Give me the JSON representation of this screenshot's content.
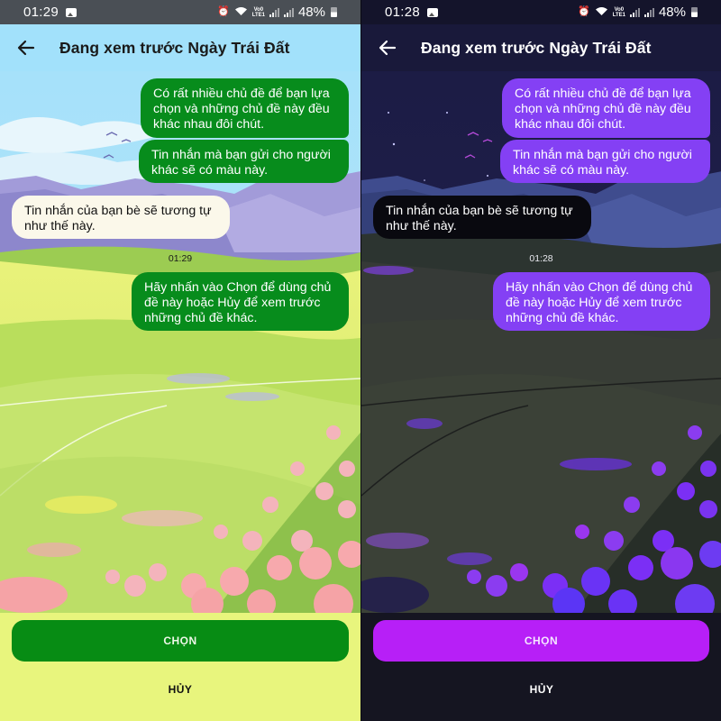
{
  "screens": [
    {
      "theme": "light",
      "status_bar": {
        "time": "01:29",
        "battery": "48%",
        "icons": [
          "gallery-icon",
          "alarm-icon",
          "wifi-icon",
          "volte-lte-icon",
          "signal-icon",
          "signal-icon",
          "battery-icon"
        ]
      },
      "app_bar": {
        "back_icon": "arrow-left-icon",
        "title": "Đang xem trước Ngày Trái Đất"
      },
      "messages": [
        {
          "direction": "outgoing",
          "text": "Có rất nhiều chủ đề để bạn lựa chọn và những chủ đề này đều khác nhau đôi chút."
        },
        {
          "direction": "outgoing",
          "text": "Tin nhắn mà bạn gửi cho người khác sẽ có màu này."
        },
        {
          "direction": "incoming",
          "text": "Tin nhắn của bạn bè sẽ tương tự như thế này."
        },
        {
          "direction": "outgoing",
          "text": "Hãy nhấn vào Chọn để dùng chủ đề này hoặc Hủy để xem trước những chủ đề khác."
        }
      ],
      "timestamp": "01:29",
      "choose_button": "CHỌN",
      "cancel_button": "HỦY",
      "colors": {
        "outgoing_bubble": "#078c1c",
        "incoming_bubble": "#fbf8ea",
        "primary_button": "#078c14",
        "app_bar": "#a2e1fb",
        "bottom_bar": "#e8f57d"
      }
    },
    {
      "theme": "dark",
      "status_bar": {
        "time": "01:28",
        "battery": "48%",
        "icons": [
          "gallery-icon",
          "alarm-icon",
          "wifi-icon",
          "volte-lte-icon",
          "signal-icon",
          "signal-icon",
          "battery-icon"
        ]
      },
      "app_bar": {
        "back_icon": "arrow-left-icon",
        "title": "Đang xem trước Ngày Trái Đất"
      },
      "messages": [
        {
          "direction": "outgoing",
          "text": "Có rất nhiều chủ đề để bạn lựa chọn và những chủ đề này đều khác nhau đôi chút."
        },
        {
          "direction": "outgoing",
          "text": "Tin nhắn mà bạn gửi cho người khác sẽ có màu này."
        },
        {
          "direction": "incoming",
          "text": "Tin nhắn của bạn bè sẽ tương tự như thế này."
        },
        {
          "direction": "outgoing",
          "text": "Hãy nhấn vào Chọn để dùng chủ đề này hoặc Hủy để xem trước những chủ đề khác."
        }
      ],
      "timestamp": "01:28",
      "choose_button": "CHỌN",
      "cancel_button": "HỦY",
      "colors": {
        "outgoing_bubble": "#8440f4",
        "incoming_bubble": "#09090f",
        "primary_button": "#b71ff7",
        "app_bar": "#19193a",
        "bottom_bar": "#151521"
      }
    }
  ]
}
